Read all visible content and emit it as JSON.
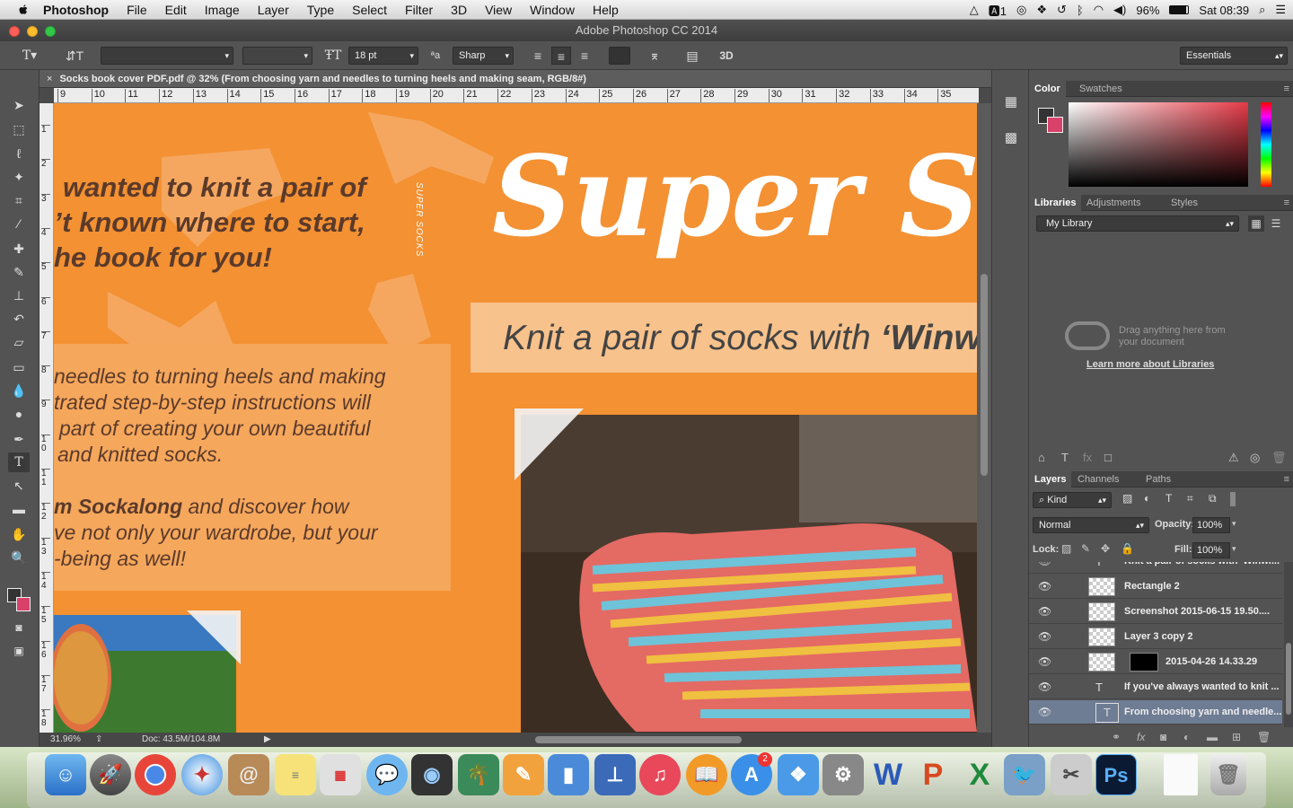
{
  "menubar": {
    "app": "Photoshop",
    "items": [
      "File",
      "Edit",
      "Image",
      "Layer",
      "Type",
      "Select",
      "Filter",
      "3D",
      "View",
      "Window",
      "Help"
    ],
    "status": {
      "adobe_count": "1",
      "battery": "96%",
      "clock": "Sat 08:39"
    }
  },
  "window": {
    "title": "Adobe Photoshop CC 2014"
  },
  "options": {
    "font_size": "18 pt",
    "antialias": "Sharp",
    "mode_3d": "3D",
    "workspace": "Essentials"
  },
  "document": {
    "tab": "Socks book cover PDF.pdf @ 32% (From choosing yarn and needles to turning heels and making seam, RGB/8#)",
    "zoom": "31.96%",
    "doc_size": "Doc: 43.5M/104.8M"
  },
  "rulers": {
    "h": [
      "9",
      "10",
      "11",
      "12",
      "13",
      "14",
      "15",
      "16",
      "17",
      "18",
      "19",
      "20",
      "21",
      "22",
      "23",
      "24",
      "25",
      "26",
      "27",
      "28",
      "29",
      "30",
      "31",
      "32",
      "33",
      "34",
      "35"
    ],
    "v": [
      "1",
      "2",
      "3",
      "4",
      "5",
      "6",
      "7",
      "8",
      "9",
      "1\n0",
      "1\n1",
      "1\n2",
      "1\n3",
      "1\n4",
      "1\n5",
      "1\n6",
      "1\n7",
      "1\n8"
    ]
  },
  "artwork": {
    "blurb_lines": [
      "wanted to knit a pair of",
      "’t known where to start,",
      "he book for you!"
    ],
    "spine": "SUPER SOCKS",
    "title": "Super So",
    "subtitle_prefix": "Knit a pair of socks with ",
    "subtitle_bold": "‘Winw",
    "body1": [
      "needles to turning heels and making",
      "trated step-by-step instructions will",
      "part of creating your own beautiful",
      "and knitted socks."
    ],
    "body2_bold": "m Sockalong",
    "body2_first_rest": " and discover how",
    "body2": [
      "ve not only your wardrobe, but your",
      "-being as well!"
    ]
  },
  "panels": {
    "color_tabs": [
      "Color",
      "Swatches"
    ],
    "library_tabs": [
      "Libraries",
      "Adjustments",
      "Styles"
    ],
    "library_select": "My Library",
    "library_hint": "Drag anything here from your document",
    "library_link": "Learn more about Libraries",
    "layers_tabs": [
      "Layers",
      "Channels",
      "Paths"
    ],
    "filter_kind": "Kind",
    "blend_mode": "Normal",
    "opacity_label": "Opacity:",
    "opacity": "100%",
    "lock_label": "Lock:",
    "fill_label": "Fill:",
    "fill": "100%",
    "layers": [
      {
        "name": "Knit a pair of socks with 'Winwi...",
        "type": "text",
        "visible": true
      },
      {
        "name": "Rectangle 2",
        "type": "pixel",
        "visible": true
      },
      {
        "name": "Screenshot 2015-06-15 19.50....",
        "type": "pixel",
        "visible": true
      },
      {
        "name": "Layer 3 copy 2",
        "type": "pixel",
        "visible": true
      },
      {
        "name": "2015-04-26 14.33.29",
        "type": "masked",
        "visible": true
      },
      {
        "name": "If you've always wanted to knit ...",
        "type": "text",
        "visible": true
      },
      {
        "name": "From choosing yarn and needle...",
        "type": "text",
        "visible": true,
        "selected": true
      }
    ]
  },
  "dock": {
    "badge": "2"
  }
}
